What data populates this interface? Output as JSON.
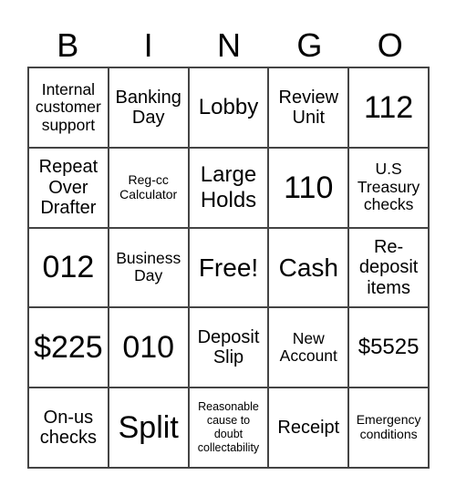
{
  "header": [
    "B",
    "I",
    "N",
    "G",
    "O"
  ],
  "cells": [
    "Internal customer support",
    "Banking Day",
    "Lobby",
    "Review Unit",
    "112",
    "Repeat Over Drafter",
    "Reg-cc Calculator",
    "Large Holds",
    "110",
    "U.S Treasury checks",
    "012",
    "Business Day",
    "Free!",
    "Cash",
    "Re-deposit items",
    "$225",
    "010",
    "Deposit Slip",
    "New Account",
    "$5525",
    "On-us checks",
    "Split",
    "Reasonable cause to doubt collectability",
    "Receipt",
    "Emergency conditions"
  ]
}
